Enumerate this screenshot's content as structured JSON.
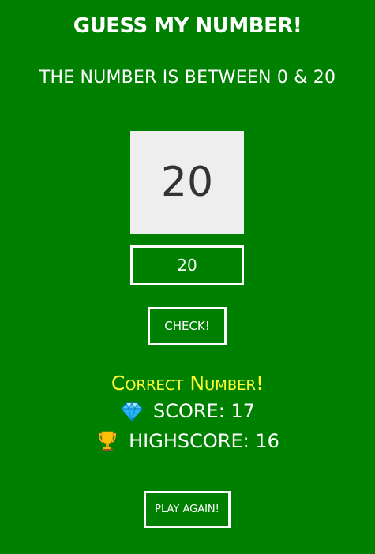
{
  "header": {
    "title": "GUESS MY NUMBER!",
    "subtitle": "THE NUMBER IS BETWEEN 0 & 20"
  },
  "secret_number": "20",
  "guess": {
    "value": "20"
  },
  "check_button": {
    "label": "CHECK!"
  },
  "message": "Correct Number!",
  "score": {
    "icon": "gem-icon",
    "label": "SCORE: 17"
  },
  "highscore": {
    "icon": "trophy-icon",
    "label": "HIGHSCORE: 16"
  },
  "play_again_button": {
    "label": "PLAY AGAIN!"
  },
  "colors": {
    "background": "#008000",
    "text": "#ffffff",
    "message": "#ffff33",
    "secret_box": "#eeeeee"
  }
}
